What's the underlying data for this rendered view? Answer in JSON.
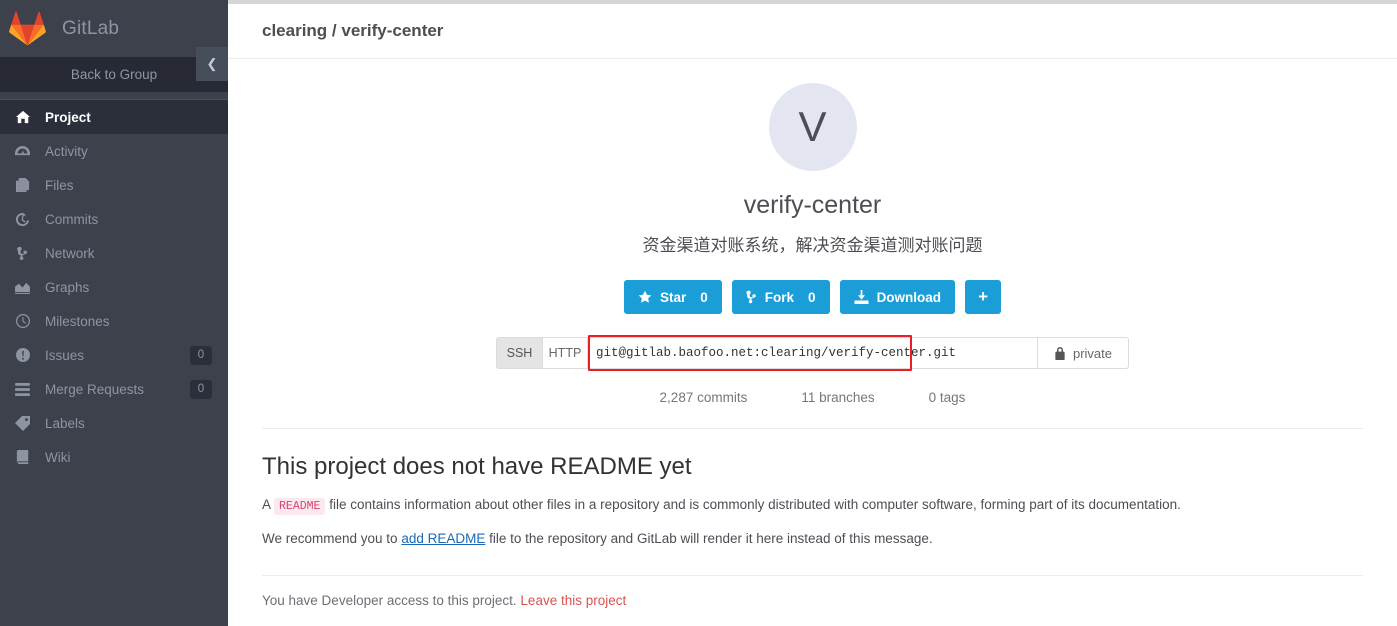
{
  "sidebar": {
    "brand": {
      "name": "GitLab",
      "logo_icon": "gitlab-fox-logo"
    },
    "collapse_icon": "chevron-left-icon",
    "back_to_group": "Back to Group",
    "items": [
      {
        "label": "Project",
        "icon": "home-icon",
        "badge": null,
        "active": true
      },
      {
        "label": "Activity",
        "icon": "dashboard-icon",
        "badge": null,
        "active": false
      },
      {
        "label": "Files",
        "icon": "files-icon",
        "badge": null,
        "active": false
      },
      {
        "label": "Commits",
        "icon": "history-icon",
        "badge": null,
        "active": false
      },
      {
        "label": "Network",
        "icon": "code-fork-icon",
        "badge": null,
        "active": false
      },
      {
        "label": "Graphs",
        "icon": "area-chart-icon",
        "badge": null,
        "active": false
      },
      {
        "label": "Milestones",
        "icon": "clock-icon",
        "badge": null,
        "active": false
      },
      {
        "label": "Issues",
        "icon": "exclamation-icon",
        "badge": "0",
        "active": false
      },
      {
        "label": "Merge Requests",
        "icon": "merge-request-icon",
        "badge": "0",
        "active": false
      },
      {
        "label": "Labels",
        "icon": "tag-icon",
        "badge": null,
        "active": false
      },
      {
        "label": "Wiki",
        "icon": "book-icon",
        "badge": null,
        "active": false
      }
    ]
  },
  "header": {
    "breadcrumb_group": "clearing",
    "breadcrumb_separator": " / ",
    "breadcrumb_project": "verify-center"
  },
  "project": {
    "avatar_letter": "V",
    "title": "verify-center",
    "description": "资金渠道对账系统，解决资金渠道测对账问题"
  },
  "actions": {
    "star": {
      "label": "Star",
      "count": "0",
      "icon": "star-icon"
    },
    "fork": {
      "label": "Fork",
      "count": "0",
      "icon": "code-fork-icon"
    },
    "download": {
      "label": "Download",
      "icon": "download-icon"
    },
    "plus": {
      "label": "+",
      "icon": "plus-icon"
    }
  },
  "clone": {
    "protocols": [
      {
        "label": "SSH",
        "active": true
      },
      {
        "label": "HTTP",
        "active": false
      }
    ],
    "url_value": "git@gitlab.baofoo.net:clearing/verify-center.git",
    "url_placeholder": "",
    "visibility": {
      "label": "private",
      "icon": "lock-icon"
    },
    "highlight_color": "#ee1d24"
  },
  "stats": [
    {
      "label": "2,287 commits"
    },
    {
      "label": "11 branches"
    },
    {
      "label": "0 tags"
    }
  ],
  "readme": {
    "title": "This project does not have README yet",
    "line1_before": "A ",
    "line1_badge": "README",
    "line1_after": " file contains information about other files in a repository and is commonly distributed with computer software, forming part of its documentation.",
    "line2_before": "We recommend you to ",
    "line2_link": "add README",
    "line2_after": " file to the repository and GitLab will render it here instead of this message."
  },
  "footer": {
    "access_text": "You have Developer access to this project.",
    "leave_link": "Leave this project"
  },
  "colors": {
    "sidebar_bg": "#3c414c",
    "sidebar_active": "#2b2f3a",
    "accent_blue": "#1b9ed8",
    "danger_red": "#d9534f",
    "highlight_red": "#ee1d24"
  }
}
